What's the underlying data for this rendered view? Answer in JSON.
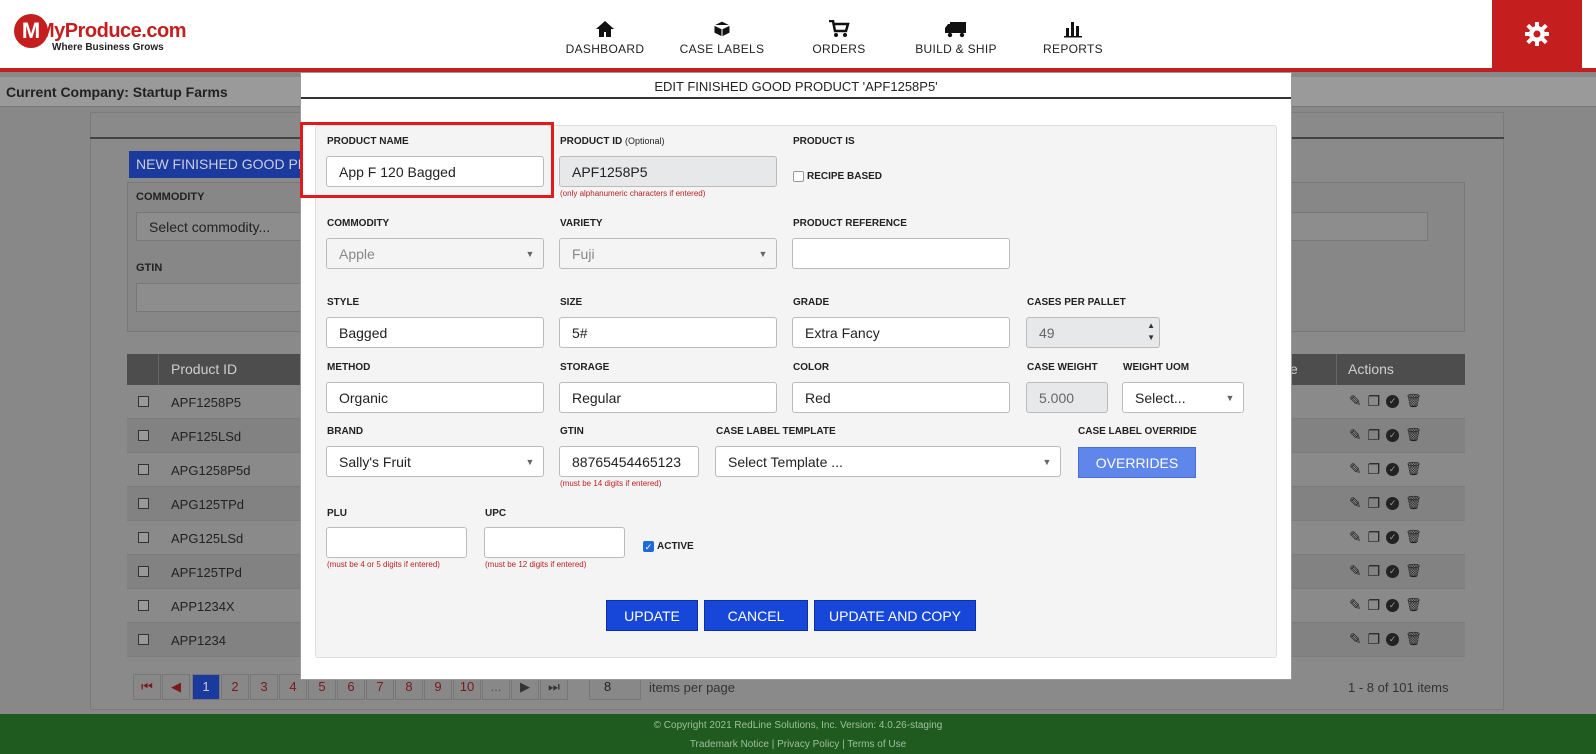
{
  "header": {
    "logo_text": "MyProduce.com",
    "logo_tagline": "Where Business Grows",
    "nav": [
      {
        "label": "DASHBOARD",
        "icon": "home-icon"
      },
      {
        "label": "CASE LABELS",
        "icon": "box-icon"
      },
      {
        "label": "ORDERS",
        "icon": "cart-icon"
      },
      {
        "label": "BUILD & SHIP",
        "icon": "truck-icon"
      },
      {
        "label": "REPORTS",
        "icon": "bar-chart-icon"
      }
    ],
    "settings_icon": "gear-icon"
  },
  "company_bar": {
    "text": "Current Company: Startup Farms"
  },
  "background": {
    "new_button": "NEW FINISHED GOOD PRO",
    "commodity_label": "COMMODITY",
    "commodity_placeholder": "Select commodity...",
    "gtin_label": "GTIN",
    "table_headers": {
      "product_id": "Product ID",
      "actions": "Actions",
      "partial": "e"
    },
    "rows": [
      "APF1258P5",
      "APF125LSd",
      "APG1258P5d",
      "APG125TPd",
      "APG125LSd",
      "APF125TPd",
      "APP1234X",
      "APP1234"
    ],
    "pager": {
      "pages": [
        "1",
        "2",
        "3",
        "4",
        "5",
        "6",
        "7",
        "8",
        "9",
        "10",
        "..."
      ],
      "first": "⏮",
      "prev": "◀",
      "next": "▶",
      "last": "⏭",
      "per_page": "8",
      "items_per_page": "items per page",
      "count": "1 - 8 of 101 items"
    }
  },
  "footer": {
    "copyright": "© Copyright 2021 RedLine Solutions, Inc. Version: 4.0.26-staging",
    "links": "Trademark Notice | Privacy Policy | Terms of Use"
  },
  "modal": {
    "title": "EDIT FINISHED GOOD PRODUCT 'APF1258P5'",
    "product_name": {
      "label": "PRODUCT NAME",
      "value": "App F 120 Bagged"
    },
    "product_id": {
      "label": "PRODUCT ID",
      "optional": "(Optional)",
      "value": "APF1258P5",
      "hint": "(only alphanumeric characters if entered)"
    },
    "product_is": {
      "label": "PRODUCT IS",
      "recipe_based": "RECIPE BASED"
    },
    "commodity": {
      "label": "COMMODITY",
      "value": "Apple"
    },
    "variety": {
      "label": "VARIETY",
      "value": "Fuji"
    },
    "product_reference": {
      "label": "PRODUCT REFERENCE",
      "value": ""
    },
    "style": {
      "label": "STYLE",
      "value": "Bagged"
    },
    "size": {
      "label": "SIZE",
      "value": "5#"
    },
    "grade": {
      "label": "GRADE",
      "value": "Extra Fancy"
    },
    "cases_per_pallet": {
      "label": "CASES PER PALLET",
      "value": "49"
    },
    "method": {
      "label": "METHOD",
      "value": "Organic"
    },
    "storage": {
      "label": "STORAGE",
      "value": "Regular"
    },
    "color": {
      "label": "COLOR",
      "value": "Red"
    },
    "case_weight": {
      "label": "CASE WEIGHT",
      "value": "5.000"
    },
    "weight_uom": {
      "label": "WEIGHT UOM",
      "value": "Select..."
    },
    "brand": {
      "label": "BRAND",
      "value": "Sally's Fruit"
    },
    "gtin": {
      "label": "GTIN",
      "value": "88765454465123",
      "hint": "(must be 14 digits if entered)"
    },
    "case_label_template": {
      "label": "CASE LABEL TEMPLATE",
      "value": "Select Template ..."
    },
    "case_label_override": {
      "label": "CASE LABEL OVERRIDE",
      "button": "OVERRIDES"
    },
    "plu": {
      "label": "PLU",
      "value": "",
      "hint": "(must be 4 or 5 digits if entered)"
    },
    "upc": {
      "label": "UPC",
      "value": "",
      "hint": "(must be 12 digits if entered)"
    },
    "active": {
      "label": "ACTIVE",
      "checked": true
    },
    "buttons": {
      "update": "UPDATE",
      "cancel": "CANCEL",
      "update_copy": "UPDATE AND COPY"
    }
  }
}
